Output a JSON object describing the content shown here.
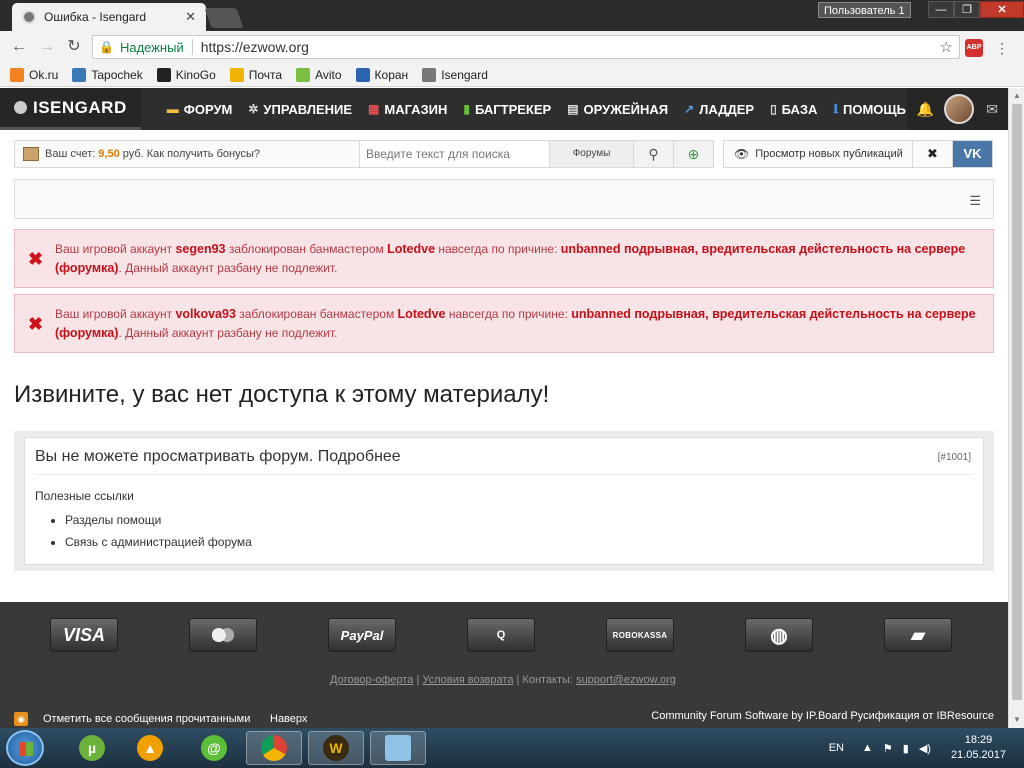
{
  "browser": {
    "tab_title": "Ошибка - Isengard",
    "user_badge": "Пользователь 1",
    "secure_label": "Надежный",
    "url": "https://ezwow.org",
    "abp": "ABP",
    "bookmarks": [
      {
        "label": "Ok.ru",
        "color": "#f58220"
      },
      {
        "label": "Tapochek",
        "color": "#3a78b8"
      },
      {
        "label": "KinoGo",
        "color": "#222222"
      },
      {
        "label": "Почта",
        "color": "#f0b400"
      },
      {
        "label": "Avito",
        "color": "#7ac143"
      },
      {
        "label": "Коран",
        "color": "#2a64b0"
      },
      {
        "label": "Isengard",
        "color": "#777777"
      }
    ]
  },
  "site": {
    "logo": "ISENGARD",
    "nav": [
      {
        "label": "ФОРУМ",
        "icon": "chat-icon"
      },
      {
        "label": "УПРАВЛЕНИЕ",
        "icon": "gear-icon"
      },
      {
        "label": "МАГАЗИН",
        "icon": "shop-icon"
      },
      {
        "label": "БАГТРЕКЕР",
        "icon": "bug-icon"
      },
      {
        "label": "ОРУЖЕЙНАЯ",
        "icon": "armory-icon"
      },
      {
        "label": "ЛАДДЕР",
        "icon": "chart-icon"
      },
      {
        "label": "БАЗА",
        "icon": "book-icon"
      },
      {
        "label": "ПОМОЩЬ",
        "icon": "info-icon"
      }
    ],
    "account": {
      "prefix": "Ваш счет:",
      "amount": "9,50",
      "suffix": "руб. Как получить бонусы?"
    },
    "search": {
      "placeholder": "Введите текст для поиска",
      "scope": "Форумы"
    },
    "view_new": "Просмотр новых публикаций",
    "vk": "VK"
  },
  "errors": [
    {
      "p1": "Ваш игровой аккаунт ",
      "account": "segen93",
      "p2": " заблокирован банмастером ",
      "banmaster": "Lotedve",
      "p3": " навсегда по причине: ",
      "reason": "unbanned подрывная, вредительская дейстельность на сервере (форумка)",
      "p4": ". Данный аккаунт разбану не подлежит."
    },
    {
      "p1": "Ваш игровой аккаунт ",
      "account": "volkova93",
      "p2": " заблокирован банмастером ",
      "banmaster": "Lotedve",
      "p3": " навсегда по причине: ",
      "reason": "unbanned подрывная, вредительская дейстельность на сервере (форумка)",
      "p4": ". Данный аккаунт разбану не подлежит."
    }
  ],
  "heading": "Извините, у вас нет доступа к этому материалу!",
  "content": {
    "title": "Вы не можете просматривать форум. Подробнее",
    "code": "[#1001]",
    "useful_links": "Полезные ссылки",
    "links": [
      "Разделы помощи",
      "Связь с администрацией форума"
    ]
  },
  "footer": {
    "payments": [
      {
        "label": "VISA",
        "cls": "visa"
      },
      {
        "label": "",
        "cls": "mastercard"
      },
      {
        "label": "PayPal",
        "cls": "paypal"
      },
      {
        "label": "Q",
        "cls": "qiwi"
      },
      {
        "label": "ROBOKASSA",
        "cls": "robo"
      },
      {
        "label": "",
        "cls": "webmoney"
      },
      {
        "label": "",
        "cls": "yandex"
      }
    ],
    "offer": "Договор-оферта",
    "refund": "Условия возврата",
    "contacts_label": "Контакты:",
    "email": "support@ezwow.org",
    "mark_read": "Отметить все сообщения прочитанными",
    "top": "Наверх",
    "powered": "Community Forum Software by IP.Board Русификация от IBResource"
  },
  "taskbar": {
    "lang": "EN",
    "time": "18:29",
    "date": "21.05.2017"
  }
}
